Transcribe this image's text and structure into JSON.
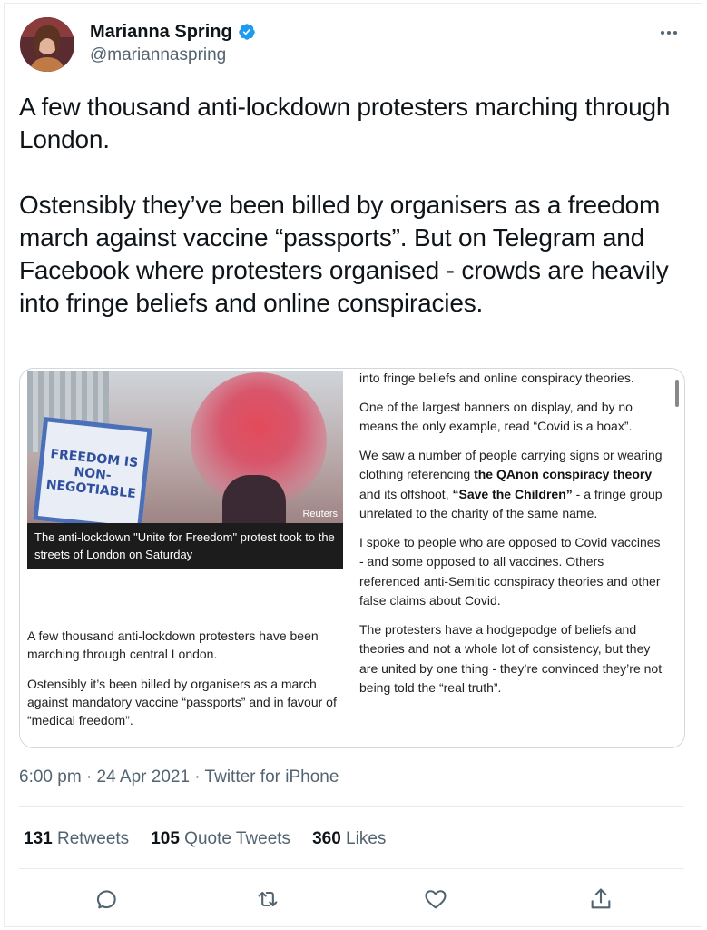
{
  "author": {
    "name": "Marianna Spring",
    "handle": "@mariannaspring",
    "verified": true,
    "avatar_icon": "avatar"
  },
  "tweet": {
    "paragraphs": [
      "A few thousand anti-lockdown protesters marching through London.",
      "Ostensibly they’ve been billed by organisers as a freedom march against vaccine “passports”. But on Telegram and Facebook where protesters organised - crowds are heavily into fringe beliefs and online conspiracies."
    ]
  },
  "card": {
    "photo": {
      "sign_lines": [
        "FREEDOM IS",
        "NON-",
        "NEGOTIABLE"
      ],
      "credit": "Reuters",
      "caption": "The anti-lockdown \"Unite for Freedom\" protest took to the streets of London on Saturday"
    },
    "left_paragraphs": [
      "A few thousand anti-lockdown protesters have been marching through central London.",
      "Ostensibly it’s been billed by organisers as a march against mandatory vaccine “passports” and in favour of “medical freedom”."
    ],
    "right": {
      "p1": "into fringe beliefs and online conspiracy theories.",
      "p2": "One of the largest banners on display, and by no means the only example, read “Covid is a hoax”.",
      "p3_a": "We saw a number of people carrying signs or wearing clothing referencing ",
      "p3_b": "the QAnon conspiracy theory",
      "p3_c": " and its offshoot, ",
      "p3_d": "“Save the Children”",
      "p3_e": " - a fringe group unrelated to the charity of the same name.",
      "p4": "I spoke to people who are opposed to Covid vaccines - and some opposed to all vaccines. Others referenced anti-Semitic conspiracy theories and other false claims about Covid.",
      "p5": "The protesters have a hodgepodge of beliefs and theories and not a whole lot of consistency, but they are united by one thing - they’re convinced they’re not being told the “real truth”."
    }
  },
  "meta": {
    "time": "6:00 pm · 24 Apr 2021 · Twitter for iPhone"
  },
  "stats": {
    "retweets_count": "131",
    "retweets_label": "Retweets",
    "quotes_count": "105",
    "quotes_label": "Quote Tweets",
    "likes_count": "360",
    "likes_label": "Likes"
  },
  "colors": {
    "text": "#0f1419",
    "secondary": "#536471",
    "verified": "#1d9bf0",
    "divider": "#e6ecf0"
  },
  "actions": [
    "reply-icon",
    "retweet-icon",
    "like-icon",
    "share-icon"
  ]
}
